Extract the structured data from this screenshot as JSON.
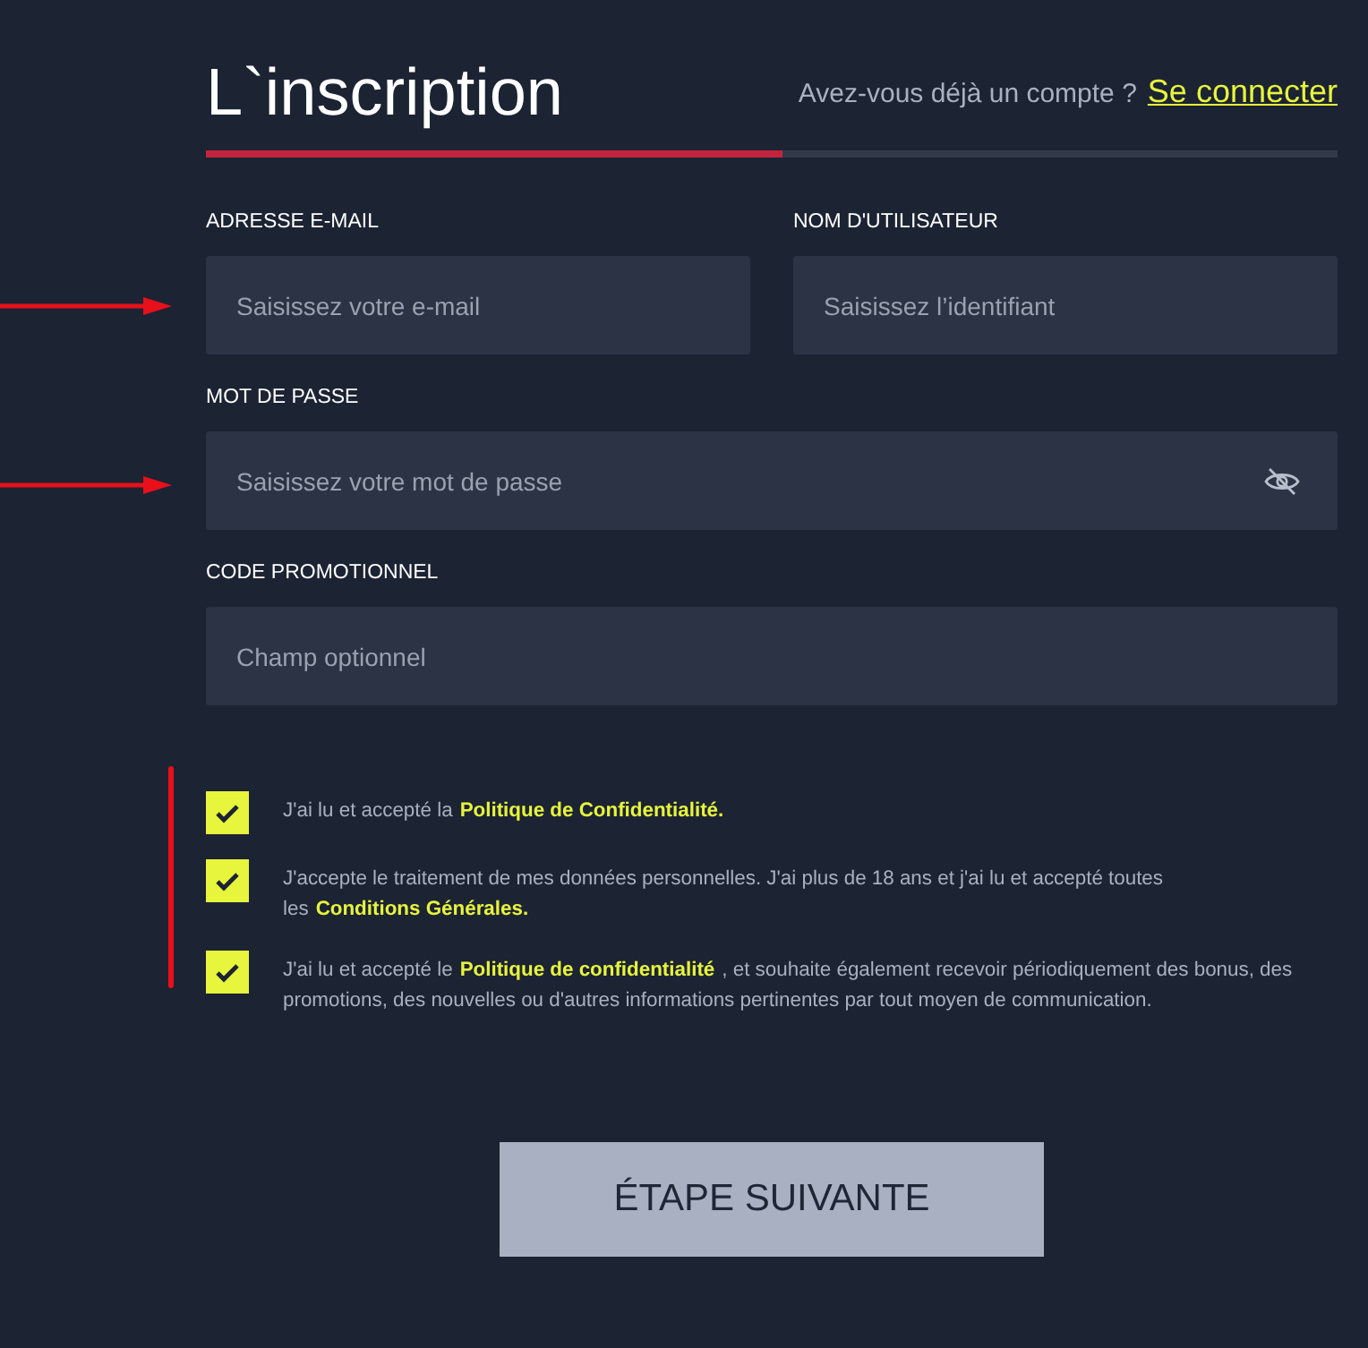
{
  "header": {
    "title": "L`inscription",
    "account_prompt": "Avez-vous déjà un compte ?",
    "login_link": "Se connecter"
  },
  "progress": {
    "level": 0.51
  },
  "field_rows": [
    [
      {
        "label": "ADRESSE E-MAIL",
        "placeholder": "Saisissez votre e-mail",
        "kind": "text"
      },
      {
        "label": "NOM D'UTILISATEUR",
        "placeholder": "Saisissez l’identifiant",
        "kind": "text"
      }
    ],
    [
      {
        "label": "MOT DE PASSE",
        "placeholder": "Saisissez votre mot de passe",
        "kind": "password"
      }
    ],
    [
      {
        "label": "CODE PROMOTIONNEL",
        "placeholder": "Champ optionnel",
        "kind": "text"
      }
    ]
  ],
  "consents": [
    {
      "checked": true,
      "before": "J'ai lu et accepté la",
      "link": "Politique de Confidentialité."
    },
    {
      "checked": true,
      "before": "J'accepte le traitement de mes données personnelles. J'ai plus de 18 ans et j'ai lu et accepté toutes les",
      "link": "Conditions Générales."
    },
    {
      "checked": true,
      "before": "J'ai lu et accepté le",
      "link": "Politique de confidentialité",
      "after": ", et souhaite également recevoir périodiquement des bonus, des promotions, des nouvelles ou d'autres informations pertinentes par tout moyen de communication."
    }
  ],
  "submit": "ÉTAPE SUIVANTE"
}
